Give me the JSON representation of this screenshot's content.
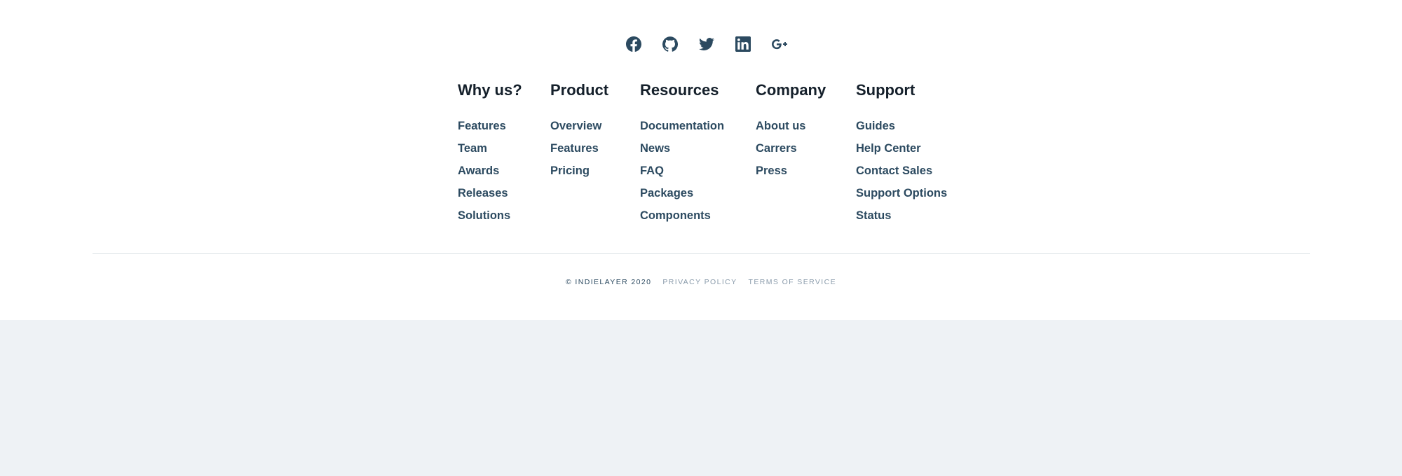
{
  "social": [
    {
      "icon": "facebook-icon"
    },
    {
      "icon": "github-icon"
    },
    {
      "icon": "twitter-icon"
    },
    {
      "icon": "linkedin-icon"
    },
    {
      "icon": "google-plus-icon"
    }
  ],
  "columns": [
    {
      "title": "Why us?",
      "links": [
        "Features",
        "Team",
        "Awards",
        "Releases",
        "Solutions"
      ]
    },
    {
      "title": "Product",
      "links": [
        "Overview",
        "Features",
        "Pricing"
      ]
    },
    {
      "title": "Resources",
      "links": [
        "Documentation",
        "News",
        "FAQ",
        "Packages",
        "Components"
      ]
    },
    {
      "title": "Company",
      "links": [
        "About us",
        "Carrers",
        "Press"
      ]
    },
    {
      "title": "Support",
      "links": [
        "Guides",
        "Help Center",
        "Contact Sales",
        "Support Options",
        "Status"
      ]
    }
  ],
  "bottom": {
    "copyright": "© INDIELAYER 2020",
    "privacy": "PRIVACY POLICY",
    "terms": "TERMS OF SERVICE"
  },
  "colors": {
    "heading": "#15202b",
    "link": "#2c4a60",
    "muted": "#8a9bab",
    "page_background": "#eef2f5"
  }
}
